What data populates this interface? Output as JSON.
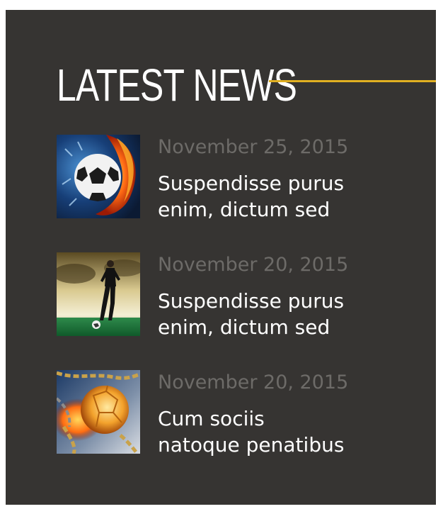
{
  "widget": {
    "title": "LATEST NEWS",
    "accent_color": "#e1b022",
    "background_color": "#363432"
  },
  "news": [
    {
      "date": "November 25, 2015",
      "headline_lines": [
        "Suspendisse purus",
        "enim, dictum sed"
      ],
      "thumbnail": "soccer-ball-fire-water-thumbnail"
    },
    {
      "date": "November 20, 2015",
      "headline_lines": [
        "Suspendisse purus",
        "enim, dictum sed"
      ],
      "thumbnail": "soccer-player-stadium-thumbnail"
    },
    {
      "date": "November 20, 2015",
      "headline_lines": [
        "Cum sociis",
        "natoque penatibus"
      ],
      "thumbnail": "flaming-ball-chains-thumbnail"
    }
  ]
}
